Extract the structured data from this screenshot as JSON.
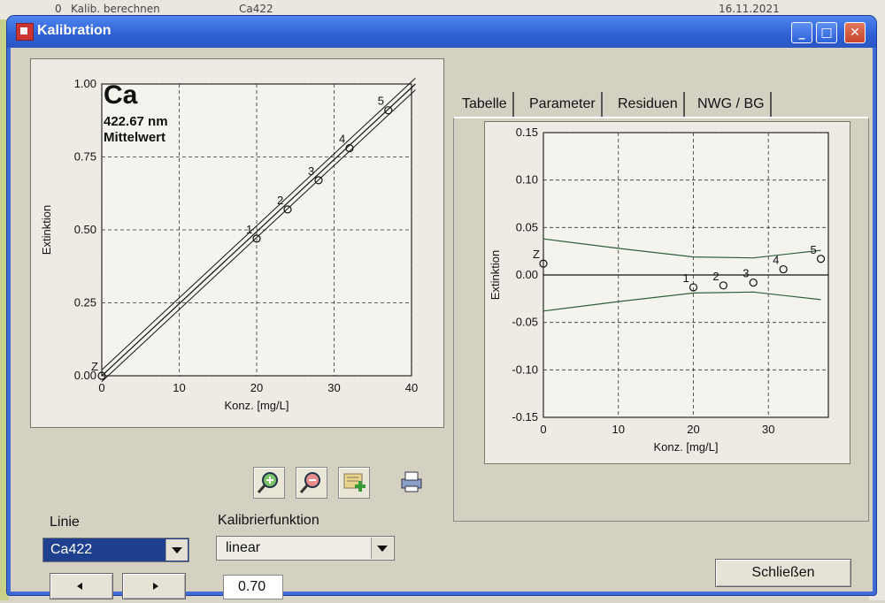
{
  "background": {
    "row_number": "0",
    "row_name": "Kalib. berechnen",
    "row_line": "Ca422",
    "row_date": "16.11.2021"
  },
  "window": {
    "title": "Kalibration",
    "minimize_icon": "minimize-icon",
    "maximize_icon": "maximize-icon",
    "close_icon": "close-icon"
  },
  "left_plot": {
    "element": "Ca",
    "wavelength": "422.67 nm",
    "mode": "Mittelwert",
    "chart_data": {
      "type": "scatter",
      "xlabel": "Konz. [mg/L]",
      "ylabel": "Extinktion",
      "xlim": [
        0,
        40
      ],
      "ylim": [
        0,
        1.0
      ],
      "x_ticks": [
        "0",
        "10",
        "20",
        "30",
        "40"
      ],
      "y_ticks": [
        "0.00",
        "0.25",
        "0.50",
        "0.75",
        "1.00"
      ],
      "grid": true,
      "points": [
        {
          "label": "Z",
          "x": 0,
          "y": 0.0
        },
        {
          "label": "1",
          "x": 20,
          "y": 0.47
        },
        {
          "label": "2",
          "x": 24,
          "y": 0.57
        },
        {
          "label": "3",
          "x": 28,
          "y": 0.67
        },
        {
          "label": "4",
          "x": 32,
          "y": 0.78
        },
        {
          "label": "5",
          "x": 37,
          "y": 0.91
        }
      ],
      "fit_line": {
        "x0": 0,
        "y0": 0.0,
        "x1": 40.5,
        "y1": 1.0
      },
      "confidence_offset": 0.02
    }
  },
  "toolbar": {
    "zoom_in_icon": "zoom-in-icon",
    "zoom_out_icon": "zoom-out-icon",
    "add_point_icon": "add-icon",
    "print_icon": "printer-icon"
  },
  "tabs": [
    {
      "label": "Tabelle"
    },
    {
      "label": "Parameter"
    },
    {
      "label": "Residuen"
    },
    {
      "label": "NWG / BG"
    }
  ],
  "active_tab": "Residuen",
  "right_plot": {
    "chart_data": {
      "type": "scatter",
      "xlabel": "Konz. [mg/L]",
      "ylabel": "Extinktion",
      "xlim": [
        0,
        38
      ],
      "ylim": [
        -0.15,
        0.15
      ],
      "x_ticks": [
        "0",
        "10",
        "20",
        "30"
      ],
      "y_ticks": [
        "0.15",
        "0.10",
        "0.05",
        "0.00",
        "-0.05",
        "-0.10",
        "-0.15"
      ],
      "grid": true,
      "points": [
        {
          "label": "Z",
          "x": 0,
          "y": 0.012
        },
        {
          "label": "1",
          "x": 20,
          "y": -0.013
        },
        {
          "label": "2",
          "x": 24,
          "y": -0.011
        },
        {
          "label": "3",
          "x": 28,
          "y": -0.008
        },
        {
          "label": "4",
          "x": 32,
          "y": 0.006
        },
        {
          "label": "5",
          "x": 37,
          "y": 0.017
        }
      ],
      "upper_band": [
        [
          0,
          0.038
        ],
        [
          10,
          0.028
        ],
        [
          20,
          0.019
        ],
        [
          28,
          0.018
        ],
        [
          37,
          0.026
        ]
      ],
      "lower_band": [
        [
          0,
          -0.038
        ],
        [
          10,
          -0.028
        ],
        [
          20,
          -0.019
        ],
        [
          28,
          -0.018
        ],
        [
          37,
          -0.026
        ]
      ]
    }
  },
  "linie": {
    "label": "Linie",
    "value": "Ca422"
  },
  "kalibrierfunktion": {
    "label": "Kalibrierfunktion",
    "value": "linear"
  },
  "correlation_value": "0.70",
  "nav": {
    "prev_icon": "arrow-left-icon",
    "next_icon": "arrow-right-icon"
  },
  "close_button": "Schließen"
}
